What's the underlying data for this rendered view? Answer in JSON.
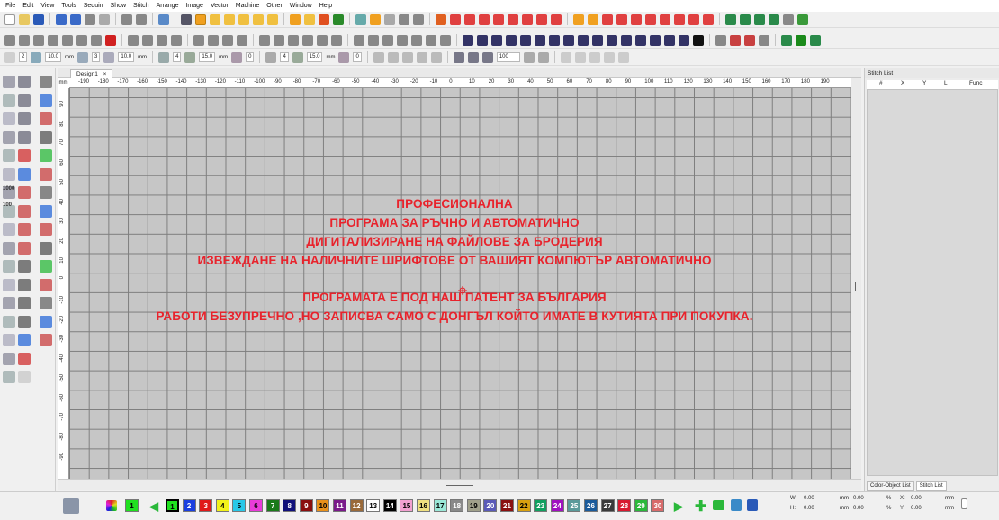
{
  "menu": [
    "File",
    "Edit",
    "View",
    "Tools",
    "Sequin",
    "Show",
    "Stitch",
    "Arrange",
    "Image",
    "Vector",
    "Machine",
    "Other",
    "Window",
    "Help"
  ],
  "param_bar": {
    "f1": "2",
    "f2": "10.0",
    "u2": "mm",
    "f3": "3",
    "f4": "10.0",
    "u4": "mm",
    "f5": "4",
    "f6": "15.0",
    "u6": "mm",
    "f7": "0",
    "f8": "4",
    "f9": "15.0",
    "u9": "mm",
    "f10": "0",
    "zoom": "100"
  },
  "left_tool_text": {
    "t1000": "1000",
    "t100": "100"
  },
  "document_tab": {
    "title": "Design1",
    "close": "×"
  },
  "ruler": {
    "unit": "mm",
    "h_labels": [
      "-190",
      "-180",
      "-170",
      "-160",
      "-150",
      "-140",
      "-130",
      "-120",
      "-110",
      "-100",
      "-90",
      "-80",
      "-70",
      "-60",
      "-50",
      "-40",
      "-30",
      "-20",
      "-10",
      "0",
      "10",
      "20",
      "30",
      "40",
      "50",
      "60",
      "70",
      "80",
      "90",
      "100",
      "110",
      "120",
      "130",
      "140",
      "150",
      "160",
      "170",
      "180",
      "190"
    ],
    "v_labels": [
      "90",
      "80",
      "70",
      "60",
      "50",
      "40",
      "30",
      "20",
      "10",
      "0",
      "-10",
      "-20",
      "-30",
      "-40",
      "-50",
      "-60",
      "-70",
      "-80",
      "-90"
    ]
  },
  "canvas_message": {
    "line1": "ПРОФЕСИОНАЛНА",
    "line2": "ПРОГРАМА ЗА РЪЧНО И АВТОМАТИЧНО",
    "line3": "ДИГИТАЛИЗИРАНЕ НА ФАЙЛОВЕ ЗА БРОДЕРИЯ",
    "line4": "ИЗВЕЖДАНЕ НА НАЛИЧНИТЕ ШРИФТОВЕ ОТ ВАШИЯТ КОМПЮТЪР АВТОМАТИЧНО",
    "line5": "ПРОГРАМАТА Е ПОД НАШ ПАТЕНТ ЗА БЪЛГАРИЯ",
    "line6": "РАБОТИ БЕЗУПРЕЧНО ,НО ЗАПИСВА САМО С ДОНГЪЛ КОЙТО ИМАТЕ В КУТИЯТА ПРИ ПОКУПКА."
  },
  "stitch_list": {
    "title": "Stitch List",
    "columns": [
      "#",
      "X",
      "Y",
      "L",
      "Func"
    ],
    "tabs": [
      "Color-Object List",
      "Stitch List"
    ]
  },
  "colors": {
    "current": "1",
    "swatches": [
      {
        "n": "1",
        "c": "#1fe01f",
        "t": "#000"
      },
      {
        "n": "2",
        "c": "#1a3fe0",
        "t": "#fff"
      },
      {
        "n": "3",
        "c": "#e01a1a",
        "t": "#fff"
      },
      {
        "n": "4",
        "c": "#f2f21a",
        "t": "#000"
      },
      {
        "n": "5",
        "c": "#28c8e8",
        "t": "#000"
      },
      {
        "n": "6",
        "c": "#e83cd8",
        "t": "#000"
      },
      {
        "n": "7",
        "c": "#1a7a1a",
        "t": "#fff"
      },
      {
        "n": "8",
        "c": "#10107a",
        "t": "#fff"
      },
      {
        "n": "9",
        "c": "#8a0e0e",
        "t": "#fff"
      },
      {
        "n": "10",
        "c": "#e8901a",
        "t": "#000"
      },
      {
        "n": "11",
        "c": "#7a1a8a",
        "t": "#fff"
      },
      {
        "n": "12",
        "c": "#9a6a3a",
        "t": "#fff"
      },
      {
        "n": "13",
        "c": "#ffffff",
        "t": "#000"
      },
      {
        "n": "14",
        "c": "#000000",
        "t": "#fff"
      },
      {
        "n": "15",
        "c": "#f2a0d0",
        "t": "#000"
      },
      {
        "n": "16",
        "c": "#f0e080",
        "t": "#000"
      },
      {
        "n": "17",
        "c": "#9ae8d8",
        "t": "#000"
      },
      {
        "n": "18",
        "c": "#8a8a8a",
        "t": "#fff"
      },
      {
        "n": "19",
        "c": "#a0a08a",
        "t": "#000"
      },
      {
        "n": "20",
        "c": "#5a5ab8",
        "t": "#fff"
      },
      {
        "n": "21",
        "c": "#8a1010",
        "t": "#fff"
      },
      {
        "n": "22",
        "c": "#d8a010",
        "t": "#000"
      },
      {
        "n": "23",
        "c": "#10a060",
        "t": "#fff"
      },
      {
        "n": "24",
        "c": "#a010c0",
        "t": "#fff"
      },
      {
        "n": "25",
        "c": "#5a9a9a",
        "t": "#fff"
      },
      {
        "n": "26",
        "c": "#1a5a9a",
        "t": "#fff"
      },
      {
        "n": "27",
        "c": "#3a3a3a",
        "t": "#fff"
      },
      {
        "n": "28",
        "c": "#d81a30",
        "t": "#fff"
      },
      {
        "n": "29",
        "c": "#2ab83a",
        "t": "#fff"
      },
      {
        "n": "30",
        "c": "#d86a6a",
        "t": "#fff"
      }
    ]
  },
  "dimensions": {
    "w_label": "W:",
    "w_value": "0.00",
    "h_label": "H:",
    "h_value": "0.00",
    "w_unit": "mm",
    "w_unit2": "0.00",
    "h_unit": "mm",
    "h_unit2": "0.00",
    "pct1": "%",
    "pct2": "%",
    "x_label": "X:",
    "x_value": "0.00",
    "y_label": "Y:",
    "y_value": "0.00",
    "x_unit": "mm",
    "y_unit": "mm"
  }
}
